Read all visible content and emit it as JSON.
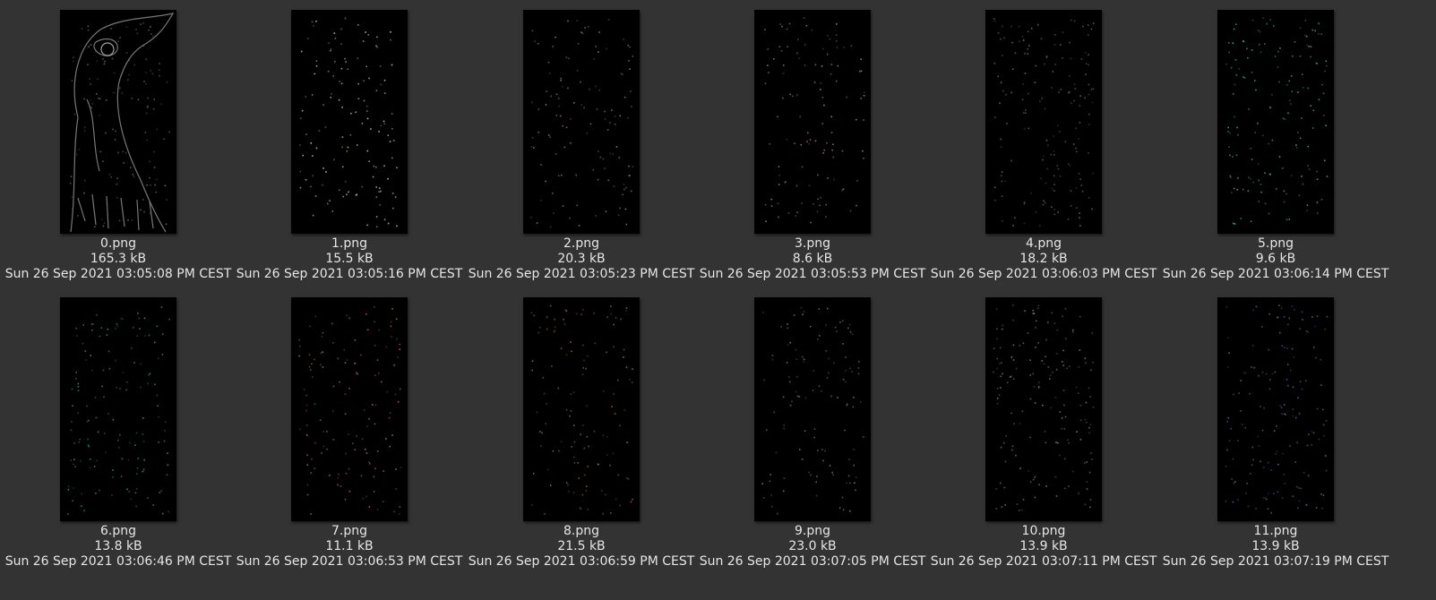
{
  "files": [
    {
      "name": "0.png",
      "size": "165.3 kB",
      "modified": "Sun 26 Sep 2021 03:05:08 PM CEST",
      "preview": "bird-head-outline-preview",
      "tint": "#8a8f8a"
    },
    {
      "name": "1.png",
      "size": "15.5 kB",
      "modified": "Sun 26 Sep 2021 03:05:16 PM CEST",
      "preview": "sparse-pixels-preview",
      "tint": "#c8b49a"
    },
    {
      "name": "2.png",
      "size": "20.3 kB",
      "modified": "Sun 26 Sep 2021 03:05:23 PM CEST",
      "preview": "sparse-pixels-preview",
      "tint": "#8c7660"
    },
    {
      "name": "3.png",
      "size": "8.6 kB",
      "modified": "Sun 26 Sep 2021 03:05:53 PM CEST",
      "preview": "sparse-pixels-preview",
      "tint": "#a07a6a"
    },
    {
      "name": "4.png",
      "size": "18.2 kB",
      "modified": "Sun 26 Sep 2021 03:06:03 PM CEST",
      "preview": "sparse-pixels-preview",
      "tint": "#7c6070"
    },
    {
      "name": "5.png",
      "size": "9.6 kB",
      "modified": "Sun 26 Sep 2021 03:06:14 PM CEST",
      "preview": "sparse-pixels-preview",
      "tint": "#3aa882"
    },
    {
      "name": "6.png",
      "size": "13.8 kB",
      "modified": "Sun 26 Sep 2021 03:06:46 PM CEST",
      "preview": "sparse-pixels-preview",
      "tint": "#2f8f86"
    },
    {
      "name": "7.png",
      "size": "11.1 kB",
      "modified": "Sun 26 Sep 2021 03:06:53 PM CEST",
      "preview": "sparse-pixels-preview",
      "tint": "#b0605a"
    },
    {
      "name": "8.png",
      "size": "21.5 kB",
      "modified": "Sun 26 Sep 2021 03:06:59 PM CEST",
      "preview": "sparse-pixels-preview",
      "tint": "#9a6450"
    },
    {
      "name": "9.png",
      "size": "23.0 kB",
      "modified": "Sun 26 Sep 2021 03:07:05 PM CEST",
      "preview": "sparse-pixels-preview",
      "tint": "#707a5c"
    },
    {
      "name": "10.png",
      "size": "13.9 kB",
      "modified": "Sun 26 Sep 2021 03:07:11 PM CEST",
      "preview": "sparse-pixels-preview",
      "tint": "#6f7a78"
    },
    {
      "name": "11.png",
      "size": "13.9 kB",
      "modified": "Sun 26 Sep 2021 03:07:19 PM CEST",
      "preview": "sparse-pixels-preview",
      "tint": "#4a6a88"
    }
  ],
  "colors": {
    "background": "#333333",
    "caption_text": "#e6e6e6",
    "thumbnail_background": "#000000"
  }
}
